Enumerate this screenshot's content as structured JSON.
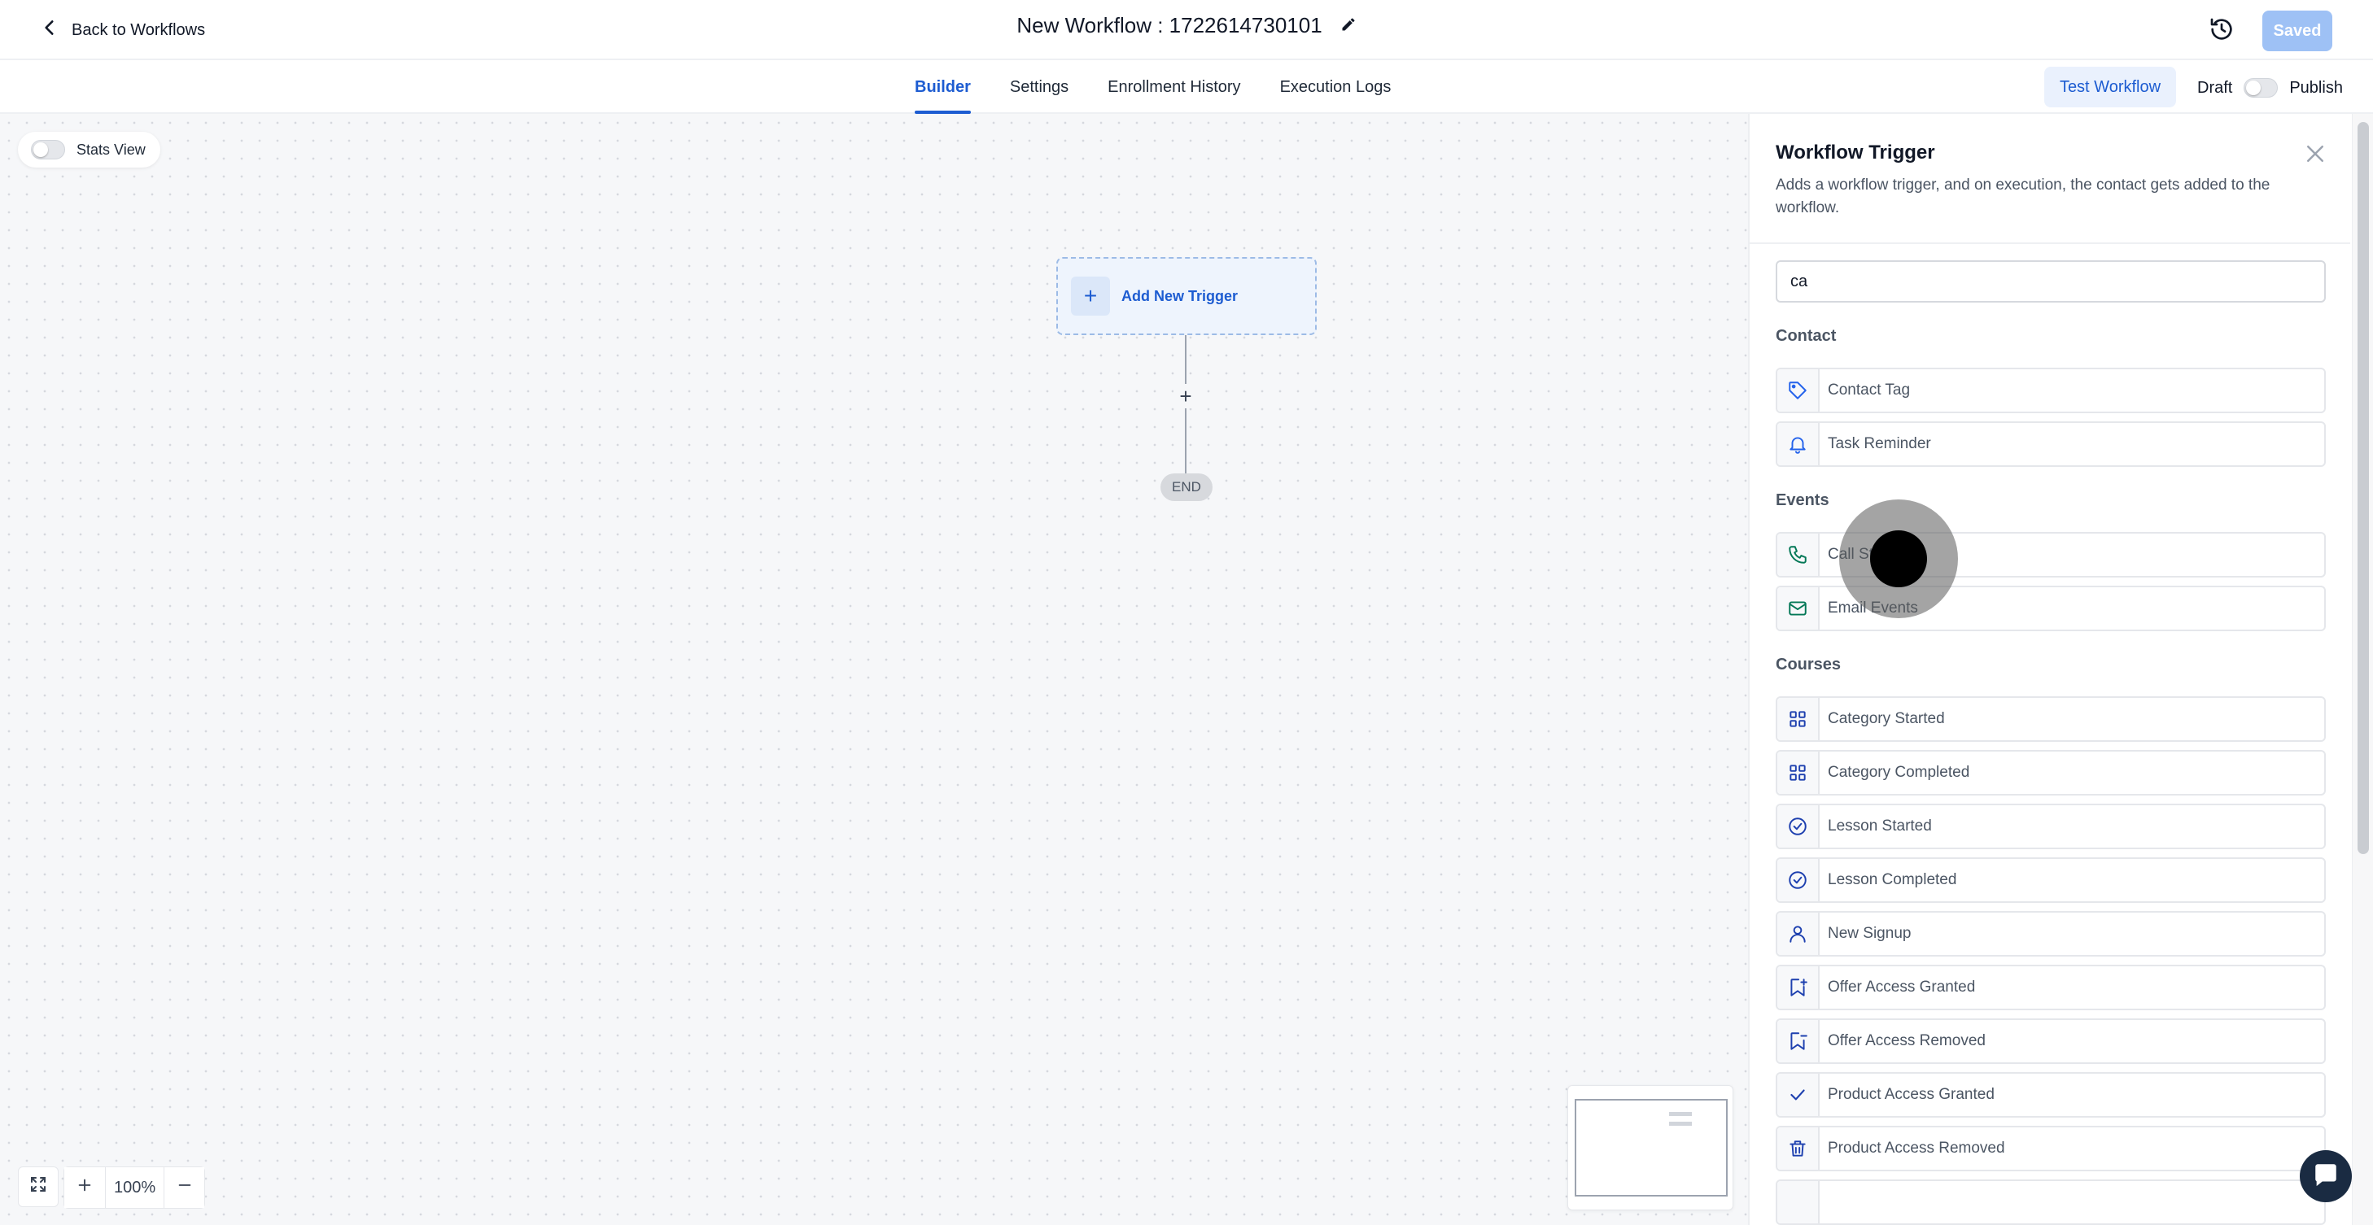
{
  "header": {
    "back_label": "Back to Workflows",
    "workflow_title": "New Workflow : 1722614730101",
    "saved_label": "Saved"
  },
  "tabs": [
    {
      "label": "Builder",
      "active": true
    },
    {
      "label": "Settings",
      "active": false
    },
    {
      "label": "Enrollment History",
      "active": false
    },
    {
      "label": "Execution Logs",
      "active": false
    }
  ],
  "actions": {
    "test_workflow_label": "Test Workflow",
    "draft_label": "Draft",
    "publish_label": "Publish",
    "published": false
  },
  "canvas": {
    "stats_view_label": "Stats View",
    "stats_view_on": false,
    "add_trigger_label": "Add New Trigger",
    "connector_plus": "+",
    "end_label": "END",
    "zoom_level": "100%"
  },
  "panel": {
    "title": "Workflow Trigger",
    "description": "Adds a workflow trigger, and on execution, the contact gets added to the workflow.",
    "search_value": "ca",
    "groups": [
      {
        "title": "Contact",
        "items": [
          {
            "label": "Contact Tag",
            "icon": "tag-icon"
          },
          {
            "label": "Task Reminder",
            "icon": "bell-icon"
          }
        ]
      },
      {
        "title": "Events",
        "items": [
          {
            "label": "Call Status",
            "icon": "phone-icon"
          },
          {
            "label": "Email Events",
            "icon": "mail-icon"
          }
        ]
      },
      {
        "title": "Courses",
        "items": [
          {
            "label": "Category Started",
            "icon": "grid-icon"
          },
          {
            "label": "Category Completed",
            "icon": "grid-icon"
          },
          {
            "label": "Lesson Started",
            "icon": "check-circle-icon"
          },
          {
            "label": "Lesson Completed",
            "icon": "check-circle-icon"
          },
          {
            "label": "New Signup",
            "icon": "user-icon"
          },
          {
            "label": "Offer Access Granted",
            "icon": "bookmark-plus-icon"
          },
          {
            "label": "Offer Access Removed",
            "icon": "bookmark-minus-icon"
          },
          {
            "label": "Product Access Granted",
            "icon": "check-icon"
          },
          {
            "label": "Product Access Removed",
            "icon": "trash-icon"
          }
        ]
      }
    ]
  },
  "colors": {
    "accent": "#1d5cd1",
    "contact_icon": "#2563eb",
    "events_icon": "#047857",
    "courses_icon": "#1e40af"
  }
}
